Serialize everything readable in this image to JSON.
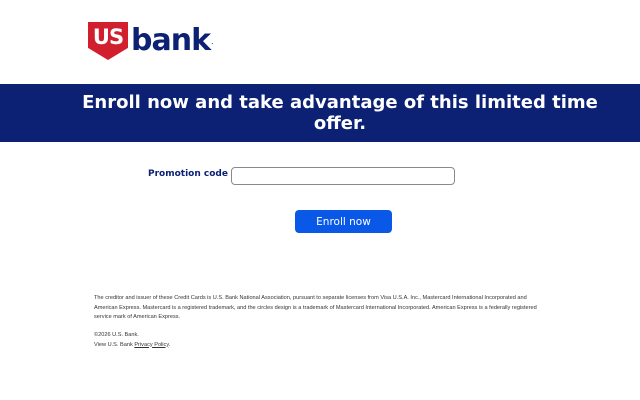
{
  "logo": {
    "shield_text": "US",
    "wordmark": "bank",
    "registered": "."
  },
  "banner": {
    "headline": "Enroll now and take advantage of this limited time offer."
  },
  "form": {
    "promo_label": "Promotion code",
    "promo_value": "",
    "enroll_label": "Enroll now"
  },
  "footer": {
    "disclaimer": "The creditor and issuer of these Credit Cards is U.S. Bank National Association, pursuant to separate licenses from Visa U.S.A. Inc., Mastercard International Incorporated and American Express. Mastercard is a registered trademark, and the circles design is a trademark of Mastercard International Incorporated. American Express is a federally registered service mark of American Express.",
    "copyright": "©2026 U.S. Bank.",
    "view_prefix": "View U.S. Bank ",
    "privacy_link": "Privacy Policy",
    "view_suffix": "."
  },
  "colors": {
    "brand_navy": "#0c2074",
    "brand_red": "#d11f2e",
    "button_blue": "#0a58e8"
  }
}
